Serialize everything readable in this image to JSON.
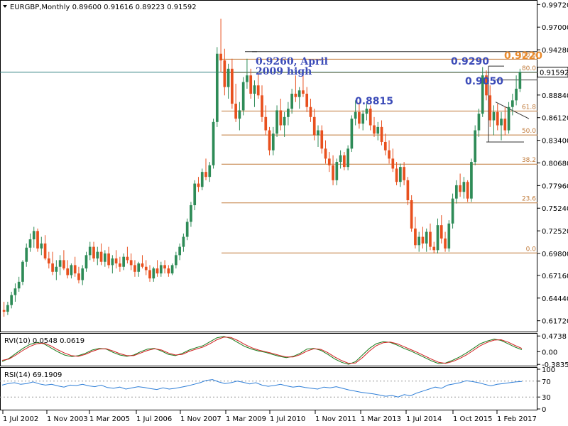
{
  "symbol_line": "EURGBP,Monthly  0.89600 0.91616 0.89223 0.91592",
  "last_price_tag": "0.91592",
  "colors": {
    "up": "#2e8b57",
    "down": "#e8501e",
    "fib": "#c07a3a",
    "ann_blue": "#3b4bb8",
    "ann_orange": "#e98a2c",
    "rvi_main": "#1a7a1a",
    "rvi_signal": "#d02020",
    "rsi": "#2f7fd8"
  },
  "chart_data": [
    {
      "type": "candlestick",
      "title": "EURGBP,Monthly",
      "ohlc_header": {
        "open": 0.896,
        "high": 0.91616,
        "low": 0.89223,
        "close": 0.91592
      },
      "ylim": [
        0.605,
        0.9992
      ],
      "y_ticks": [
        "0.99720",
        "0.97000",
        "0.94280",
        "0.91560",
        "0.88840",
        "0.86120",
        "0.83400",
        "0.80680",
        "0.77960",
        "0.75240",
        "0.72520",
        "0.69800",
        "0.67160",
        "0.64440",
        "0.61720"
      ],
      "x_tick_labels": [
        "1 Jul 2002",
        "1 Nov 2003",
        "1 Mar 2005",
        "1 Jul 2006",
        "1 Nov 2007",
        "1 Mar 2009",
        "1 Jul 2010",
        "1 Nov 2011",
        "1 Mar 2013",
        "1 Jul 2014",
        "1 Oct 2015",
        "1 Feb 2017"
      ],
      "fibonacci_levels": [
        {
          "label": "100.0",
          "value": 0.9315
        },
        {
          "label": "80.0",
          "value": 0.9155
        },
        {
          "label": "61.8",
          "value": 0.8692
        },
        {
          "label": "50.0",
          "value": 0.8404
        },
        {
          "label": "38.2",
          "value": 0.8053
        },
        {
          "label": "23.6",
          "value": 0.7588
        },
        {
          "label": "0.0",
          "value": 0.6986
        }
      ],
      "annotations": [
        {
          "text": "0.9260, April",
          "value": 0.926
        },
        {
          "text": "2009 high",
          "value": 0.926
        },
        {
          "text": "0.8815",
          "value": 0.8815
        },
        {
          "text": "0.9290",
          "value": 0.929
        },
        {
          "text": "0.9220",
          "value": 0.922
        },
        {
          "text": "0.9050",
          "value": 0.905
        }
      ],
      "candles": [
        [
          0.63,
          0.64,
          0.622,
          0.628
        ],
        [
          0.628,
          0.64,
          0.624,
          0.636
        ],
        [
          0.636,
          0.652,
          0.632,
          0.648
        ],
        [
          0.648,
          0.662,
          0.64,
          0.656
        ],
        [
          0.656,
          0.67,
          0.652,
          0.664
        ],
        [
          0.664,
          0.69,
          0.66,
          0.688
        ],
        [
          0.688,
          0.71,
          0.682,
          0.705
        ],
        [
          0.705,
          0.722,
          0.7,
          0.715
        ],
        [
          0.715,
          0.73,
          0.705,
          0.725
        ],
        [
          0.725,
          0.728,
          0.7,
          0.704
        ],
        [
          0.704,
          0.718,
          0.696,
          0.71
        ],
        [
          0.71,
          0.72,
          0.69,
          0.692
        ],
        [
          0.692,
          0.7,
          0.68,
          0.686
        ],
        [
          0.686,
          0.7,
          0.672,
          0.676
        ],
        [
          0.676,
          0.69,
          0.666,
          0.682
        ],
        [
          0.682,
          0.696,
          0.672,
          0.69
        ],
        [
          0.69,
          0.702,
          0.678,
          0.68
        ],
        [
          0.68,
          0.69,
          0.668,
          0.672
        ],
        [
          0.672,
          0.686,
          0.668,
          0.684
        ],
        [
          0.684,
          0.694,
          0.67,
          0.674
        ],
        [
          0.674,
          0.682,
          0.662,
          0.666
        ],
        [
          0.666,
          0.684,
          0.66,
          0.68
        ],
        [
          0.68,
          0.7,
          0.676,
          0.696
        ],
        [
          0.696,
          0.712,
          0.69,
          0.706
        ],
        [
          0.706,
          0.712,
          0.688,
          0.692
        ],
        [
          0.692,
          0.706,
          0.684,
          0.7
        ],
        [
          0.7,
          0.71,
          0.684,
          0.688
        ],
        [
          0.688,
          0.702,
          0.682,
          0.698
        ],
        [
          0.698,
          0.706,
          0.68,
          0.684
        ],
        [
          0.684,
          0.696,
          0.674,
          0.692
        ],
        [
          0.692,
          0.702,
          0.68,
          0.686
        ],
        [
          0.686,
          0.694,
          0.676,
          0.682
        ],
        [
          0.682,
          0.698,
          0.678,
          0.694
        ],
        [
          0.694,
          0.706,
          0.686,
          0.69
        ],
        [
          0.69,
          0.698,
          0.678,
          0.684
        ],
        [
          0.684,
          0.69,
          0.67,
          0.676
        ],
        [
          0.676,
          0.688,
          0.67,
          0.686
        ],
        [
          0.686,
          0.696,
          0.68,
          0.682
        ],
        [
          0.682,
          0.69,
          0.672,
          0.678
        ],
        [
          0.678,
          0.684,
          0.664,
          0.668
        ],
        [
          0.668,
          0.682,
          0.664,
          0.68
        ],
        [
          0.68,
          0.69,
          0.67,
          0.674
        ],
        [
          0.674,
          0.688,
          0.67,
          0.684
        ],
        [
          0.684,
          0.69,
          0.674,
          0.68
        ],
        [
          0.68,
          0.684,
          0.67,
          0.674
        ],
        [
          0.674,
          0.686,
          0.672,
          0.684
        ],
        [
          0.684,
          0.7,
          0.68,
          0.696
        ],
        [
          0.696,
          0.71,
          0.69,
          0.706
        ],
        [
          0.706,
          0.722,
          0.7,
          0.718
        ],
        [
          0.718,
          0.74,
          0.714,
          0.736
        ],
        [
          0.736,
          0.76,
          0.73,
          0.756
        ],
        [
          0.756,
          0.786,
          0.75,
          0.782
        ],
        [
          0.782,
          0.79,
          0.772,
          0.778
        ],
        [
          0.778,
          0.8,
          0.774,
          0.796
        ],
        [
          0.796,
          0.812,
          0.786,
          0.79
        ],
        [
          0.79,
          0.808,
          0.784,
          0.804
        ],
        [
          0.804,
          0.86,
          0.8,
          0.856
        ],
        [
          0.856,
          0.946,
          0.85,
          0.938
        ],
        [
          0.938,
          0.98,
          0.916,
          0.93
        ],
        [
          0.93,
          0.944,
          0.888,
          0.898
        ],
        [
          0.898,
          0.926,
          0.884,
          0.92
        ],
        [
          0.92,
          0.932,
          0.872,
          0.878
        ],
        [
          0.878,
          0.902,
          0.856,
          0.86
        ],
        [
          0.86,
          0.88,
          0.846,
          0.87
        ],
        [
          0.87,
          0.91,
          0.864,
          0.904
        ],
        [
          0.904,
          0.932,
          0.896,
          0.912
        ],
        [
          0.912,
          0.92,
          0.884,
          0.89
        ],
        [
          0.89,
          0.906,
          0.874,
          0.9
        ],
        [
          0.9,
          0.914,
          0.884,
          0.888
        ],
        [
          0.888,
          0.9,
          0.856,
          0.862
        ],
        [
          0.862,
          0.876,
          0.84,
          0.846
        ],
        [
          0.846,
          0.85,
          0.816,
          0.822
        ],
        [
          0.822,
          0.85,
          0.816,
          0.842
        ],
        [
          0.842,
          0.876,
          0.838,
          0.87
        ],
        [
          0.87,
          0.884,
          0.846,
          0.852
        ],
        [
          0.852,
          0.868,
          0.838,
          0.862
        ],
        [
          0.862,
          0.88,
          0.852,
          0.872
        ],
        [
          0.872,
          0.896,
          0.866,
          0.89
        ],
        [
          0.89,
          0.912,
          0.88,
          0.886
        ],
        [
          0.886,
          0.898,
          0.872,
          0.894
        ],
        [
          0.894,
          0.912,
          0.886,
          0.89
        ],
        [
          0.89,
          0.898,
          0.868,
          0.874
        ],
        [
          0.874,
          0.884,
          0.856,
          0.862
        ],
        [
          0.862,
          0.872,
          0.834,
          0.84
        ],
        [
          0.84,
          0.852,
          0.826,
          0.846
        ],
        [
          0.846,
          0.852,
          0.818,
          0.824
        ],
        [
          0.824,
          0.834,
          0.806,
          0.812
        ],
        [
          0.812,
          0.82,
          0.796,
          0.804
        ],
        [
          0.804,
          0.816,
          0.78,
          0.786
        ],
        [
          0.786,
          0.812,
          0.78,
          0.808
        ],
        [
          0.808,
          0.822,
          0.8,
          0.816
        ],
        [
          0.816,
          0.82,
          0.798,
          0.802
        ],
        [
          0.802,
          0.828,
          0.798,
          0.824
        ],
        [
          0.824,
          0.864,
          0.82,
          0.86
        ],
        [
          0.86,
          0.882,
          0.852,
          0.868
        ],
        [
          0.868,
          0.88,
          0.848,
          0.854
        ],
        [
          0.854,
          0.87,
          0.846,
          0.866
        ],
        [
          0.866,
          0.88,
          0.858,
          0.872
        ],
        [
          0.872,
          0.876,
          0.846,
          0.852
        ],
        [
          0.852,
          0.862,
          0.838,
          0.842
        ],
        [
          0.842,
          0.856,
          0.834,
          0.85
        ],
        [
          0.85,
          0.858,
          0.828,
          0.832
        ],
        [
          0.832,
          0.842,
          0.816,
          0.822
        ],
        [
          0.822,
          0.834,
          0.806,
          0.812
        ],
        [
          0.812,
          0.824,
          0.796,
          0.8
        ],
        [
          0.8,
          0.808,
          0.78,
          0.784
        ],
        [
          0.784,
          0.806,
          0.778,
          0.802
        ],
        [
          0.802,
          0.808,
          0.78,
          0.786
        ],
        [
          0.786,
          0.79,
          0.756,
          0.762
        ],
        [
          0.762,
          0.768,
          0.724,
          0.728
        ],
        [
          0.728,
          0.742,
          0.704,
          0.708
        ],
        [
          0.708,
          0.724,
          0.7,
          0.718
        ],
        [
          0.718,
          0.73,
          0.704,
          0.71
        ],
        [
          0.71,
          0.728,
          0.7,
          0.724
        ],
        [
          0.724,
          0.734,
          0.702,
          0.706
        ],
        [
          0.706,
          0.712,
          0.698,
          0.702
        ],
        [
          0.702,
          0.74,
          0.698,
          0.732
        ],
        [
          0.732,
          0.744,
          0.71,
          0.716
        ],
        [
          0.716,
          0.724,
          0.7,
          0.704
        ],
        [
          0.704,
          0.738,
          0.7,
          0.734
        ],
        [
          0.734,
          0.77,
          0.728,
          0.764
        ],
        [
          0.764,
          0.786,
          0.758,
          0.78
        ],
        [
          0.78,
          0.794,
          0.766,
          0.772
        ],
        [
          0.772,
          0.79,
          0.764,
          0.784
        ],
        [
          0.784,
          0.786,
          0.76,
          0.764
        ],
        [
          0.764,
          0.812,
          0.76,
          0.808
        ],
        [
          0.808,
          0.852,
          0.804,
          0.846
        ],
        [
          0.846,
          0.872,
          0.838,
          0.866
        ],
        [
          0.866,
          0.922,
          0.862,
          0.912
        ],
        [
          0.912,
          0.918,
          0.882,
          0.888
        ],
        [
          0.888,
          0.9,
          0.85,
          0.858
        ],
        [
          0.858,
          0.876,
          0.84,
          0.868
        ],
        [
          0.868,
          0.878,
          0.846,
          0.852
        ],
        [
          0.852,
          0.868,
          0.834,
          0.86
        ],
        [
          0.86,
          0.874,
          0.84,
          0.846
        ],
        [
          0.846,
          0.88,
          0.842,
          0.874
        ],
        [
          0.874,
          0.89,
          0.864,
          0.882
        ],
        [
          0.882,
          0.912,
          0.876,
          0.896
        ],
        [
          0.896,
          0.92,
          0.892,
          0.91592
        ]
      ]
    },
    {
      "type": "line",
      "title": "RVI(10) 0.0548 0.0619",
      "ylim": [
        -0.4,
        0.5
      ],
      "y_ticks": [
        "0.4738",
        "0.00",
        "-0.3835"
      ],
      "series": [
        {
          "values": [
            -0.3,
            -0.2,
            -0.05,
            0.1,
            0.22,
            0.28,
            0.24,
            0.12,
            0.0,
            -0.1,
            -0.15,
            -0.12,
            -0.05,
            0.05,
            0.1,
            0.08,
            -0.02,
            -0.1,
            -0.14,
            -0.1,
            0.0,
            0.08,
            0.1,
            0.02,
            -0.08,
            -0.12,
            -0.05,
            0.05,
            0.12,
            0.18,
            0.3,
            0.42,
            0.46,
            0.4,
            0.28,
            0.16,
            0.08,
            0.02,
            -0.02,
            -0.08,
            -0.14,
            -0.18,
            -0.14,
            -0.05,
            0.08,
            0.1,
            0.04,
            -0.08,
            -0.22,
            -0.32,
            -0.38,
            -0.3,
            -0.1,
            0.1,
            0.24,
            0.3,
            0.28,
            0.2,
            0.1,
            0.02,
            -0.08,
            -0.18,
            -0.28,
            -0.36,
            -0.34,
            -0.26,
            -0.16,
            -0.04,
            0.1,
            0.24,
            0.32,
            0.38,
            0.34,
            0.24,
            0.14,
            0.06
          ]
        },
        {
          "values": [
            -0.26,
            -0.22,
            -0.1,
            0.04,
            0.16,
            0.24,
            0.26,
            0.18,
            0.06,
            -0.04,
            -0.12,
            -0.14,
            -0.08,
            0.01,
            0.08,
            0.09,
            0.02,
            -0.06,
            -0.12,
            -0.12,
            -0.04,
            0.04,
            0.09,
            0.05,
            -0.04,
            -0.1,
            -0.08,
            0.01,
            0.08,
            0.14,
            0.24,
            0.36,
            0.44,
            0.43,
            0.34,
            0.22,
            0.12,
            0.05,
            0.0,
            -0.05,
            -0.11,
            -0.16,
            -0.16,
            -0.09,
            0.02,
            0.09,
            0.07,
            -0.03,
            -0.16,
            -0.27,
            -0.35,
            -0.34,
            -0.18,
            0.02,
            0.18,
            0.27,
            0.29,
            0.24,
            0.15,
            0.06,
            -0.03,
            -0.13,
            -0.23,
            -0.32,
            -0.35,
            -0.3,
            -0.21,
            -0.1,
            0.04,
            0.18,
            0.28,
            0.35,
            0.36,
            0.29,
            0.19,
            0.1
          ]
        }
      ]
    },
    {
      "type": "line",
      "title": "RSI(14) 69.1909",
      "ylim": [
        0,
        100
      ],
      "y_ticks": [
        "100",
        "70",
        "30",
        "0"
      ],
      "series": [
        {
          "values": [
            60,
            64,
            66,
            62,
            64,
            68,
            63,
            60,
            62,
            58,
            55,
            60,
            59,
            62,
            58,
            56,
            60,
            54,
            52,
            55,
            50,
            53,
            56,
            54,
            51,
            49,
            53,
            50,
            52,
            55,
            58,
            62,
            66,
            72,
            74,
            68,
            64,
            66,
            70,
            67,
            63,
            66,
            60,
            57,
            59,
            62,
            58,
            55,
            57,
            54,
            52,
            50,
            55,
            53,
            56,
            52,
            48,
            45,
            42,
            40,
            38,
            35,
            32,
            34,
            30,
            36,
            33,
            40,
            45,
            50,
            55,
            52,
            60,
            63,
            66,
            71,
            69,
            66,
            62,
            58,
            62,
            64,
            66,
            68,
            69.19
          ]
        }
      ]
    }
  ]
}
